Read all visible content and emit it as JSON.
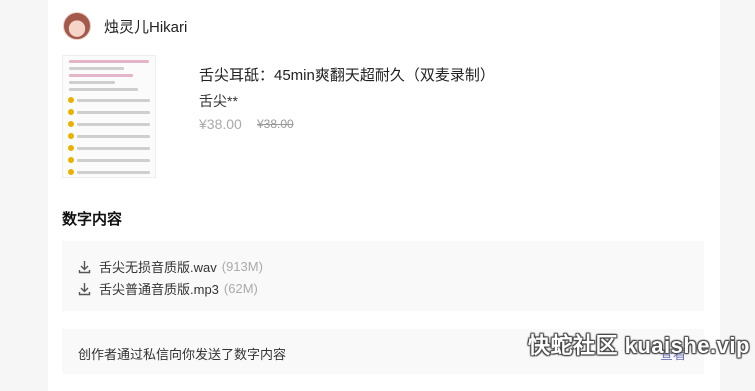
{
  "creator": {
    "name": "烛灵儿Hikari"
  },
  "product": {
    "title": "舌尖耳舐：45min爽翻天超耐久（双麦录制）",
    "subtitle": "舌尖**",
    "price": "¥38.00",
    "original_price": "¥38.00"
  },
  "digital": {
    "section_title": "数字内容",
    "files": [
      {
        "name": "舌尖无损音质版.wav",
        "size": "(913M)"
      },
      {
        "name": "舌尖普通音质版.mp3",
        "size": "(62M)"
      }
    ]
  },
  "notice": {
    "text": "创作者通过私信向你发送了数字内容",
    "link": "查看"
  },
  "watermark": "快蛇社区 kuaishe.vip",
  "icons": {
    "download": "download-icon",
    "avatar": "avatar"
  }
}
